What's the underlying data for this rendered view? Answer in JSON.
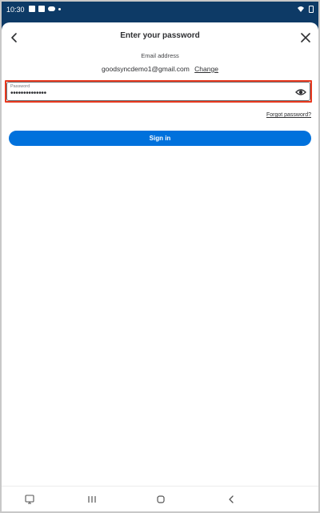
{
  "status_bar": {
    "time": "10:30"
  },
  "sheet": {
    "title": "Enter your password",
    "email_label": "Email address",
    "email": "goodsyncdemo1@gmail.com",
    "change_label": "Change",
    "password": {
      "label": "Password",
      "value": "••••••••••••••"
    },
    "forgot_label": "Forgot password?",
    "signin_label": "Sign in"
  },
  "colors": {
    "primary": "#0071dc",
    "highlight": "#e8391f",
    "statusbar": "#0d3a66"
  },
  "icons": [
    "back-arrow-icon",
    "close-icon",
    "eye-icon",
    "screenshot-icon",
    "recents-icon",
    "home-icon",
    "nav-back-icon"
  ]
}
